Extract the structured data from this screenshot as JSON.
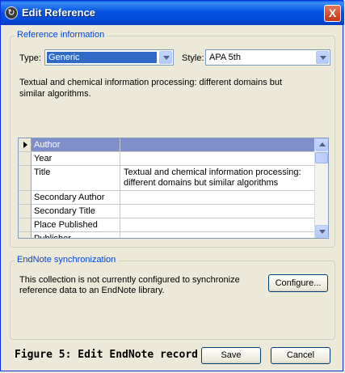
{
  "window": {
    "title": "Edit Reference",
    "close_label": "X"
  },
  "reference_info": {
    "legend": "Reference information",
    "type_label": "Type:",
    "type_value": "Generic",
    "style_label": "Style:",
    "style_value": "APA 5th",
    "summary": "Textual and chemical information processing: different domains but similar algorithms."
  },
  "grid": {
    "rows": [
      {
        "field": "Author",
        "value": ""
      },
      {
        "field": "Year",
        "value": ""
      },
      {
        "field": "Title",
        "value": "Textual and chemical information processing: different domains but similar algorithms"
      },
      {
        "field": "Secondary Author",
        "value": ""
      },
      {
        "field": "Secondary Title",
        "value": ""
      },
      {
        "field": "Place Published",
        "value": ""
      },
      {
        "field": "Publisher",
        "value": ""
      }
    ]
  },
  "sync": {
    "legend": "EndNote synchronization",
    "message": "This collection is not currently configured to synchronize reference data to an EndNote library.",
    "configure_label": "Configure..."
  },
  "caption": "Figure 5: Edit EndNote record",
  "buttons": {
    "save_label": "Save",
    "cancel_label": "Cancel"
  }
}
